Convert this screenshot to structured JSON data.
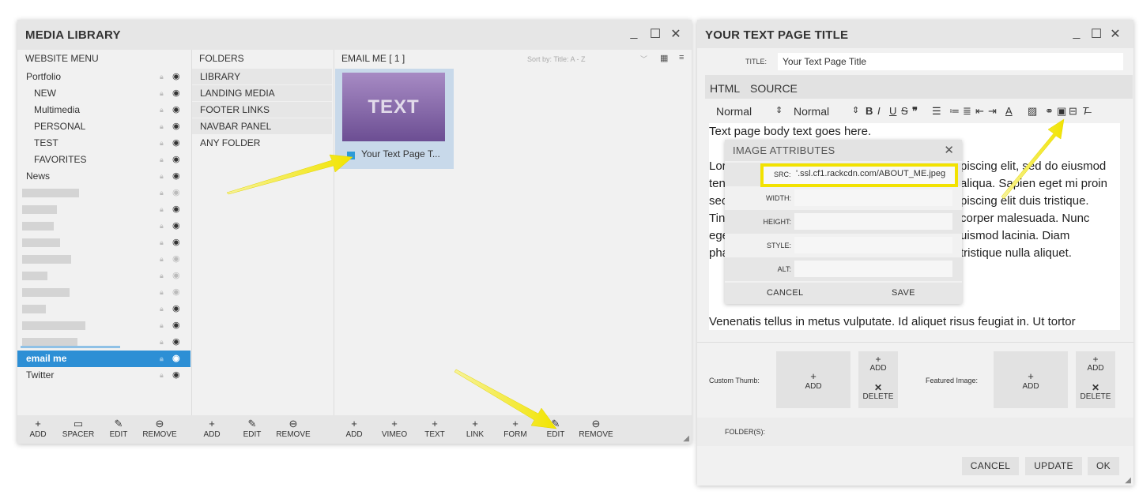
{
  "media_library": {
    "title": "MEDIA LIBRARY",
    "website_menu_header": "WEBSITE MENU",
    "folders_header": "FOLDERS",
    "list_header": "EMAIL ME [ 1 ]",
    "sort_by": "Sort by:  Title: A - Z",
    "menu_items": [
      {
        "label": "Portfolio",
        "sub": false
      },
      {
        "label": "NEW",
        "sub": true
      },
      {
        "label": "Multimedia",
        "sub": true
      },
      {
        "label": "PERSONAL",
        "sub": true
      },
      {
        "label": "TEST",
        "sub": true
      },
      {
        "label": "FAVORITES",
        "sub": true
      },
      {
        "label": "News",
        "sub": false
      }
    ],
    "selected_item": "email me",
    "last_item": "Twitter",
    "folders": [
      "LIBRARY",
      "LANDING MEDIA",
      "FOOTER LINKS",
      "NAVBAR PANEL",
      "ANY FOLDER"
    ],
    "thumbnail": {
      "image_text": "TEXT",
      "label": "Your Text Page T..."
    },
    "menu_toolbar": [
      "ADD",
      "SPACER",
      "EDIT",
      "REMOVE"
    ],
    "folder_toolbar": [
      "ADD",
      "EDIT",
      "REMOVE"
    ],
    "list_toolbar": [
      "ADD",
      "VIMEO",
      "TEXT",
      "LINK",
      "FORM",
      "EDIT",
      "REMOVE"
    ]
  },
  "text_page": {
    "title": "YOUR TEXT PAGE TITLE",
    "title_label": "TITLE:",
    "title_value": "Your Text Page Title",
    "tabs": [
      "HTML",
      "SOURCE"
    ],
    "format_select": "Normal",
    "size_select": "Normal",
    "editor_lines": [
      "Text page body text goes here.",
      "",
      "Lor",
      "ten",
      "sec",
      "Tin",
      "ege",
      "pha"
    ],
    "editor_right_lines": [
      "piscing elit, sed do eiusmod",
      "aliqua. Sapien eget mi proin",
      "piscing elit duis tristique.",
      "corper malesuada. Nunc",
      "uismod lacinia. Diam",
      "tristique nulla aliquet."
    ],
    "editor_last_line": "Venenatis tellus in metus vulputate. Id aliquet risus feugiat in. Ut tortor",
    "custom_thumb_label": "Custom Thumb:",
    "featured_image_label": "Featured Image:",
    "add_label": "ADD",
    "delete_label": "DELETE",
    "folders_label": "FOLDER(S):",
    "cancel_label": "CANCEL",
    "update_label": "UPDATE",
    "ok_label": "OK"
  },
  "image_attributes": {
    "title": "IMAGE ATTRIBUTES",
    "src_label": "SRC:",
    "src_value": "'.ssl.cf1.rackcdn.com/ABOUT_ME.jpeg",
    "width_label": "WIDTH:",
    "height_label": "HEIGHT:",
    "style_label": "STYLE:",
    "alt_label": "ALT:",
    "cancel_label": "CANCEL",
    "save_label": "SAVE"
  },
  "colors": {
    "selection": "#2d8fd5",
    "highlight": "#f2e200",
    "thumb_purple": "#7b5ba1"
  }
}
